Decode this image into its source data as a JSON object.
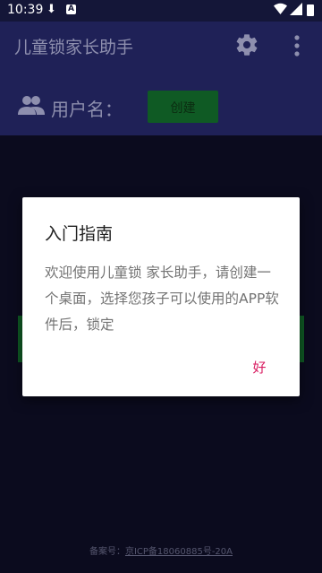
{
  "status_bar": {
    "time": "10:39"
  },
  "app_bar": {
    "title": "儿童锁家长助手",
    "settings_icon": "gear-icon",
    "more_icon": "more-vert-icon"
  },
  "user_row": {
    "icon": "people-icon",
    "label": "用户名：",
    "create_button": "创建"
  },
  "footer": {
    "prefix": "备案号：",
    "icp": "京ICP备18060885号-20A"
  },
  "dialog": {
    "title": "入门指南",
    "message": "欢迎使用儿童锁 家长助手，请创建一个桌面，选择您孩子可以使用的APP软件后，锁定",
    "ok_button": "好"
  },
  "colors": {
    "app_bar": "#1f2157",
    "accent_button": "#0f5a24",
    "dialog_action": "#d81b60"
  }
}
